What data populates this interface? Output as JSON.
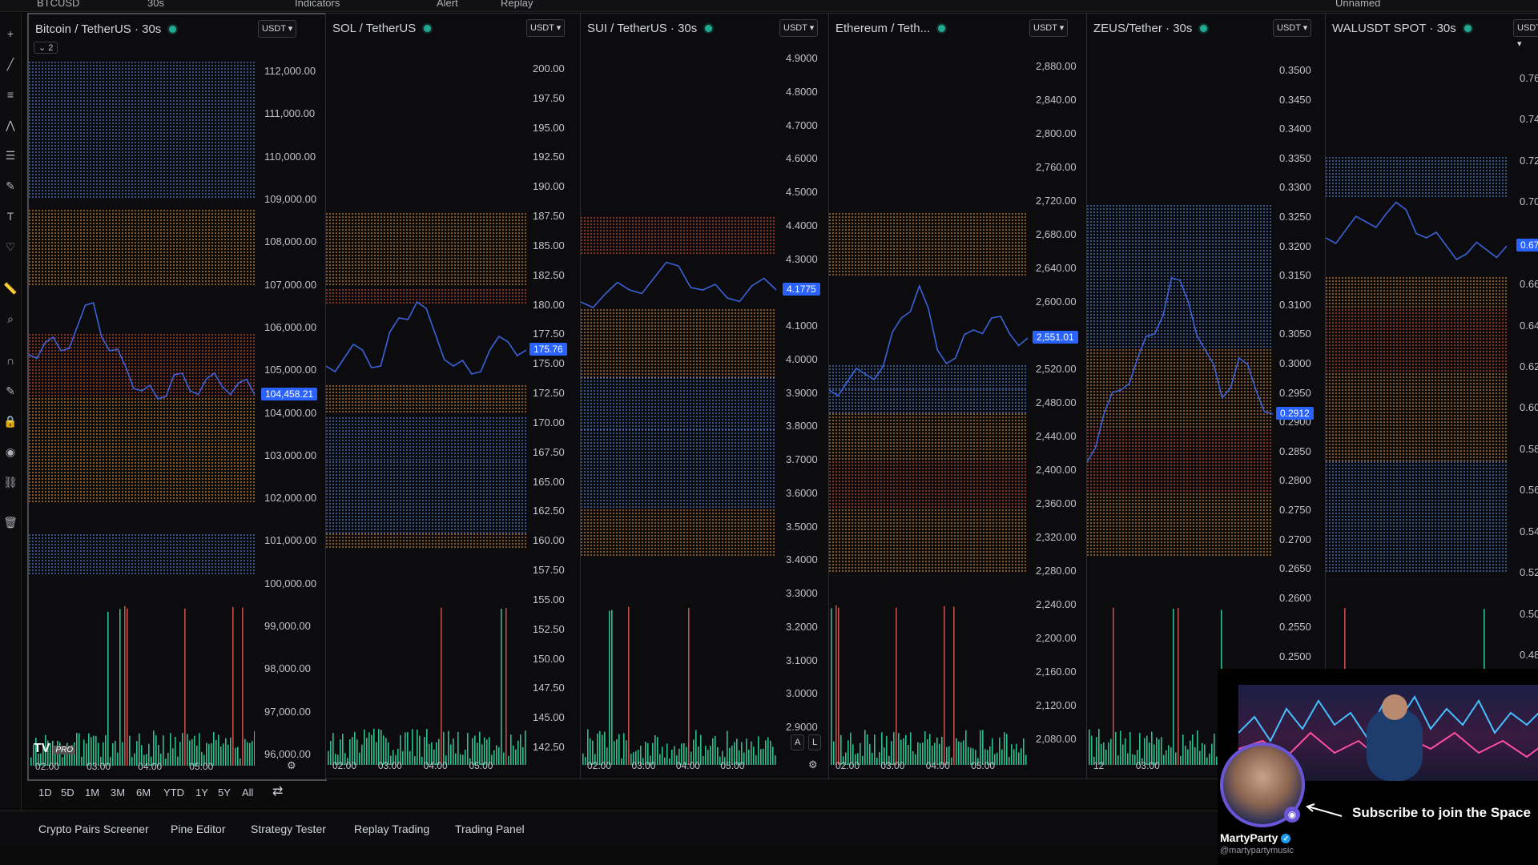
{
  "colors": {
    "price_line": "#3a63d8",
    "badge": "#2962ff",
    "volume": "#2fbf8f",
    "heat_blue": "#5b87e8",
    "heat_orange": "#e8923a",
    "heat_red": "#e0503a",
    "live_dot": "#22ab94"
  },
  "topbar": {
    "symbol": "BTCUSD",
    "interval": "30s",
    "indicators": "Indicators",
    "alert": "Alert",
    "replay": "Replay",
    "layout": "Unnamed"
  },
  "panels": [
    {
      "title": "Bitcoin / TetherUS · 30s",
      "unit": "USDT",
      "collapse": "2",
      "price_labels": [
        "112,000.00",
        "111,000.00",
        "110,000.00",
        "109,000.00",
        "108,000.00",
        "107,000.00",
        "106,000.00",
        "105,000.00",
        "104,000.00",
        "103,000.00",
        "102,000.00",
        "101,000.00",
        "100,000.00",
        "99,000.00",
        "98,000.00",
        "97,000.00",
        "96,000.00"
      ],
      "last_price": "104,458.21",
      "time_labels": [
        "02:00",
        "03:00",
        "04:00",
        "05:00"
      ]
    },
    {
      "title": "SOL / TetherUS",
      "unit": "USDT",
      "price_labels": [
        "200.00",
        "197.50",
        "195.00",
        "192.50",
        "190.00",
        "187.50",
        "185.00",
        "182.50",
        "180.00",
        "177.50",
        "175.00",
        "172.50",
        "170.00",
        "167.50",
        "165.00",
        "162.50",
        "160.00",
        "157.50",
        "155.00",
        "152.50",
        "150.00",
        "147.50",
        "145.00",
        "142.50"
      ],
      "last_price": "175.76",
      "time_labels": [
        "02:00",
        "03:00",
        "04:00",
        "05:00"
      ]
    },
    {
      "title": "SUI / TetherUS · 30s",
      "unit": "USDT",
      "price_labels": [
        "4.9000",
        "4.8000",
        "4.7000",
        "4.6000",
        "4.5000",
        "4.4000",
        "4.3000",
        "4.2000",
        "4.1000",
        "4.0000",
        "3.9000",
        "3.8000",
        "3.7000",
        "3.6000",
        "3.5000",
        "3.4000",
        "3.3000",
        "3.2000",
        "3.1000",
        "3.0000",
        "2.9000"
      ],
      "last_price": "4.1775",
      "time_labels": [
        "02:00",
        "03:00",
        "04:00",
        "05:00"
      ],
      "scale_buttons": [
        "A",
        "L"
      ]
    },
    {
      "title": "Ethereum / Teth...",
      "unit": "USDT",
      "price_labels": [
        "2,880.00",
        "2,840.00",
        "2,800.00",
        "2,760.00",
        "2,720.00",
        "2,680.00",
        "2,640.00",
        "2,600.00",
        "2,560.00",
        "2,520.00",
        "2,480.00",
        "2,440.00",
        "2,400.00",
        "2,360.00",
        "2,320.00",
        "2,280.00",
        "2,240.00",
        "2,200.00",
        "2,160.00",
        "2,120.00",
        "2,080.00"
      ],
      "last_price": "2,551.01",
      "time_labels": [
        "02:00",
        "03:00",
        "04:00",
        "05:00"
      ]
    },
    {
      "title": "ZEUS/Tether · 30s",
      "unit": "USDT",
      "price_labels": [
        "0.3500",
        "0.3450",
        "0.3400",
        "0.3350",
        "0.3300",
        "0.3250",
        "0.3200",
        "0.3150",
        "0.3100",
        "0.3050",
        "0.3000",
        "0.2950",
        "0.2900",
        "0.2850",
        "0.2800",
        "0.2750",
        "0.2700",
        "0.2650",
        "0.2600",
        "0.2550",
        "0.2500"
      ],
      "last_price": "0.2912",
      "time_labels": [
        "12",
        "03:00"
      ]
    },
    {
      "title": "WALUSDT SPOT · 30s",
      "unit": "USDT",
      "price_labels": [
        "0.76",
        "0.74",
        "0.72",
        "0.70",
        "0.68",
        "0.66",
        "0.64",
        "0.62",
        "0.60",
        "0.58",
        "0.56",
        "0.54",
        "0.52",
        "0.50",
        "0.48"
      ],
      "last_price": "0.67",
      "time_labels": []
    }
  ],
  "ranges": [
    "1D",
    "5D",
    "1M",
    "3M",
    "6M",
    "YTD",
    "1Y",
    "5Y",
    "All"
  ],
  "bottom_tabs": [
    "Crypto Pairs Screener",
    "Pine Editor",
    "Strategy Tester",
    "Replay Trading",
    "Trading Panel"
  ],
  "overlay": {
    "name": "MartyParty",
    "handle": "@martypartymusic",
    "cta": "Subscribe to join the Space"
  },
  "logo": {
    "text": "TV",
    "badge": "PRO"
  }
}
